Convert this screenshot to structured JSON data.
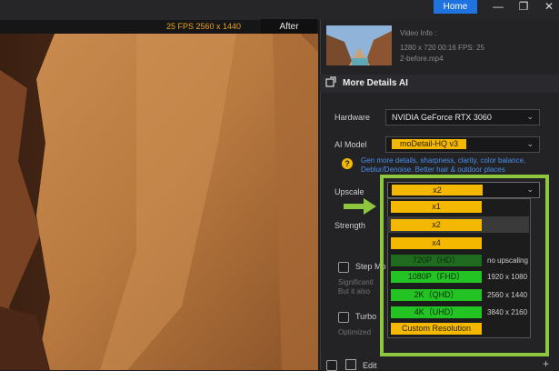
{
  "top": {
    "home_label": "Home",
    "minimize": "—",
    "restore": "❐",
    "close": "✕"
  },
  "preview": {
    "stats": "25 FPS  2560 x 1440",
    "after_label": "After"
  },
  "video_info": {
    "title": "Video Info :",
    "line1": "1280 x 720  00:16    FPS: 25",
    "file": "2-before.mp4"
  },
  "section": {
    "title": "More Details AI",
    "icon": "compare-icon"
  },
  "hardware": {
    "label": "Hardware",
    "value": "NVIDIA GeForce RTX 3060"
  },
  "ai_model": {
    "label": "AI Model",
    "value": "moDetail-HQ  v3",
    "hint1": "Gen more details, sharpness, clarity, color balance,",
    "hint2": "Deblur/Denoise. Better hair & outdoor places"
  },
  "upscale": {
    "label": "Upscale",
    "value": "x2"
  },
  "strength": {
    "label": "Strength"
  },
  "step_mode": {
    "label": "Step Mo",
    "text1": "Significantl",
    "text2": "But it also"
  },
  "turbo": {
    "label": "Turbo",
    "text1": "Optimized"
  },
  "edit": {
    "label": "Edit",
    "plus": "+"
  },
  "dropdown": {
    "options": [
      {
        "label": "x1",
        "style": "y",
        "res": ""
      },
      {
        "label": "x2",
        "style": "y",
        "res": ""
      },
      {
        "label": "x4",
        "style": "y",
        "res": ""
      },
      {
        "label": "720P（HD）",
        "style": "gd",
        "res": "no upscaling"
      },
      {
        "label": "1080P（FHD）",
        "style": "g",
        "res": "1920 x 1080"
      },
      {
        "label": "2K（QHD）",
        "style": "g",
        "res": "2560 x 1440"
      },
      {
        "label": "4K（UHD）",
        "style": "g",
        "res": "3840 x 2160"
      },
      {
        "label": "Custom Resolution",
        "style": "y",
        "res": ""
      }
    ]
  },
  "colors": {
    "accent": "#f5b800",
    "highlight": "#8ec63f",
    "home": "#1f73e0"
  }
}
